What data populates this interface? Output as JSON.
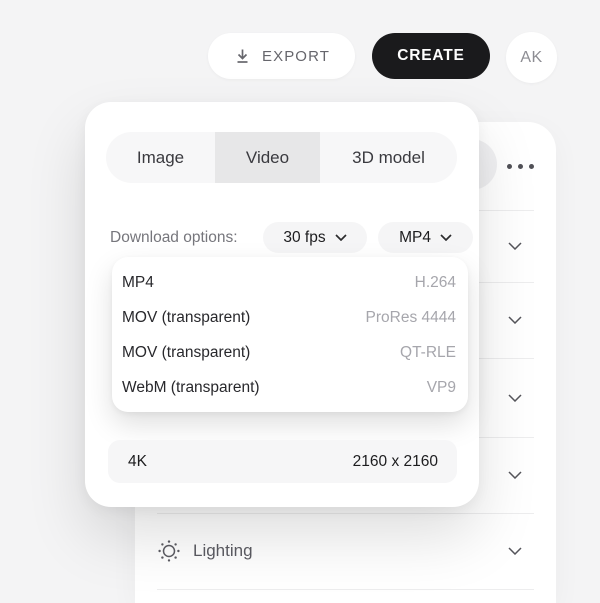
{
  "top_bar": {
    "export_label": "EXPORT",
    "create_label": "CREATE",
    "avatar_initials": "AK"
  },
  "export_popup": {
    "tabs": [
      {
        "label": "Image"
      },
      {
        "label": "Video"
      },
      {
        "label": "3D model"
      }
    ],
    "selected_tab": "Video",
    "download_options_label": "Download options:",
    "fps_dropdown_value": "30 fps",
    "format_dropdown_value": "MP4",
    "format_menu_items": [
      {
        "label": "MP4",
        "codec": "H.264"
      },
      {
        "label": "MOV (transparent)",
        "codec": "ProRes 4444"
      },
      {
        "label": "MOV (transparent)",
        "codec": "QT-RLE"
      },
      {
        "label": "WebM (transparent)",
        "codec": "VP9"
      }
    ],
    "resolution_label": "4K",
    "resolution_value": "2160 x 2160"
  },
  "properties_panel": {
    "lighting_label": "Lighting"
  },
  "colors": {
    "page_bg": "#f4f4f5",
    "create_button_bg": "#1a1a1c",
    "selected_tab_bg": "#e7e7e8",
    "pill_bg": "#f5f5f6",
    "muted_text": "#76767c",
    "codec_text": "#a6a6ac"
  }
}
